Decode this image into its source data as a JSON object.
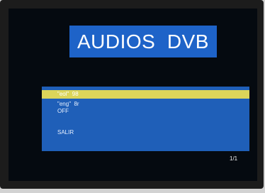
{
  "header": {
    "title": "AUDIOS  DVB"
  },
  "menu": {
    "items": [
      {
        "label": "\"eol\"  98"
      },
      {
        "label": "\"eng\"  8r"
      },
      {
        "label": "OFF"
      },
      {
        "label": "SALIR"
      }
    ],
    "selected_index": 0
  },
  "footer": {
    "page": "1/1"
  },
  "colors": {
    "screen_bg": "#050a10",
    "panel_blue": "#1f5fb8",
    "title_blue": "#1e63c8",
    "highlight_yellow": "#dcd55a"
  }
}
